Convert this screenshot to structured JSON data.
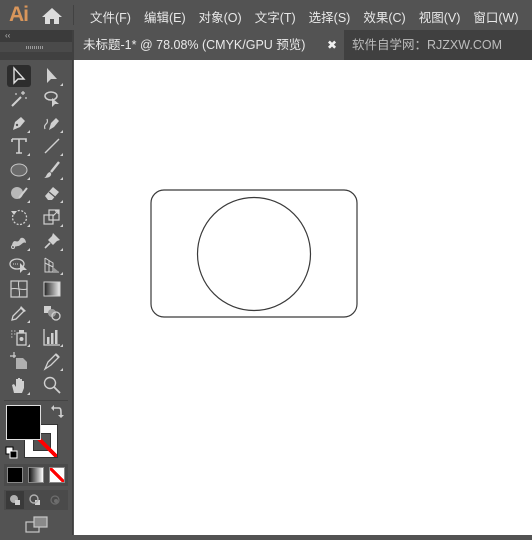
{
  "app": {
    "logo": "Ai",
    "home_icon": "home-icon"
  },
  "menu": [
    "文件(F)",
    "编辑(E)",
    "对象(O)",
    "文字(T)",
    "选择(S)",
    "效果(C)",
    "视图(V)",
    "窗口(W)"
  ],
  "panel": {
    "collapse_label": "‹‹"
  },
  "tabs": {
    "active": {
      "label": "未标题-1* @ 78.08% (CMYK/GPU 预览)",
      "close": "✖"
    },
    "inactive": {
      "label": "软件自学网：RJZXW.COM"
    }
  },
  "tools": [
    {
      "name": "selection-tool",
      "selected": true
    },
    {
      "name": "direct-selection-tool"
    },
    {
      "name": "magic-wand-tool"
    },
    {
      "name": "lasso-tool"
    },
    {
      "name": "pen-tool"
    },
    {
      "name": "curvature-tool"
    },
    {
      "name": "type-tool"
    },
    {
      "name": "line-segment-tool"
    },
    {
      "name": "ellipse-tool"
    },
    {
      "name": "paintbrush-tool"
    },
    {
      "name": "shaper-tool"
    },
    {
      "name": "eraser-tool"
    },
    {
      "name": "rotate-tool"
    },
    {
      "name": "scale-tool"
    },
    {
      "name": "puppet-warp-tool"
    },
    {
      "name": "pin-tool"
    },
    {
      "name": "shape-builder-tool"
    },
    {
      "name": "perspective-grid-tool"
    },
    {
      "name": "mesh-tool"
    },
    {
      "name": "gradient-tool"
    },
    {
      "name": "eyedropper-tool"
    },
    {
      "name": "blend-tool"
    },
    {
      "name": "symbol-sprayer-tool"
    },
    {
      "name": "column-graph-tool"
    },
    {
      "name": "artboard-tool"
    },
    {
      "name": "slice-tool"
    },
    {
      "name": "hand-tool"
    },
    {
      "name": "zoom-tool"
    }
  ],
  "colors": {
    "fill": "#000000",
    "stroke": "none",
    "accent_logo": "#d9965b",
    "none_slash": "#ff0000"
  },
  "canvas": {
    "shapes": [
      {
        "type": "rounded-rectangle",
        "stroke": "#333333",
        "fill": "none"
      },
      {
        "type": "circle",
        "stroke": "#333333",
        "fill": "none"
      }
    ]
  }
}
